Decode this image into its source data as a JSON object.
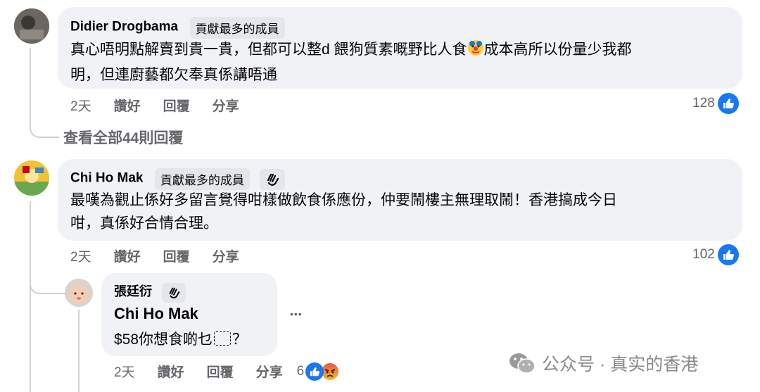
{
  "comments": [
    {
      "author": "Didier Drogbama",
      "badge": "貢獻最多的成員",
      "text_line1": "真心唔明點解賣到貴一貴，但都可以整d 餵狗質素嘅野比人食",
      "text_line1b": "成本高所以份量少我都",
      "text_line2": "明，但連廚藝都欠奉真係講唔通",
      "time": "2天",
      "like_action": "讚好",
      "reply_action": "回覆",
      "share_action": "分享",
      "like_count": "128"
    },
    {
      "author": "Chi Ho Mak",
      "badge": "貢獻最多的成員",
      "text_line1": "最嘆為觀止係好多留言覺得咁樣做飲食係應份，仲要鬧樓主無理取鬧！香港搞成今日",
      "text_line2": "咁，真係好合情合理。",
      "time": "2天",
      "like_action": "讚好",
      "reply_action": "回覆",
      "share_action": "分享",
      "like_count": "102"
    }
  ],
  "view_replies": "查看全部44則回覆",
  "reply": {
    "author": "張廷衍",
    "mention": "Chi Ho Mak",
    "text_prefix": "$58你想食啲乜",
    "text_suffix": "？",
    "more": "•••",
    "time": "2天",
    "like_action": "讚好",
    "reply_action": "回覆",
    "share_action": "分享",
    "reaction_count": "6"
  },
  "watermark": "公众号 · 真实的香港",
  "colors": {
    "bubble": "#f0f2f5",
    "like_blue": "#1877f2",
    "meta_gray": "#65676b"
  }
}
